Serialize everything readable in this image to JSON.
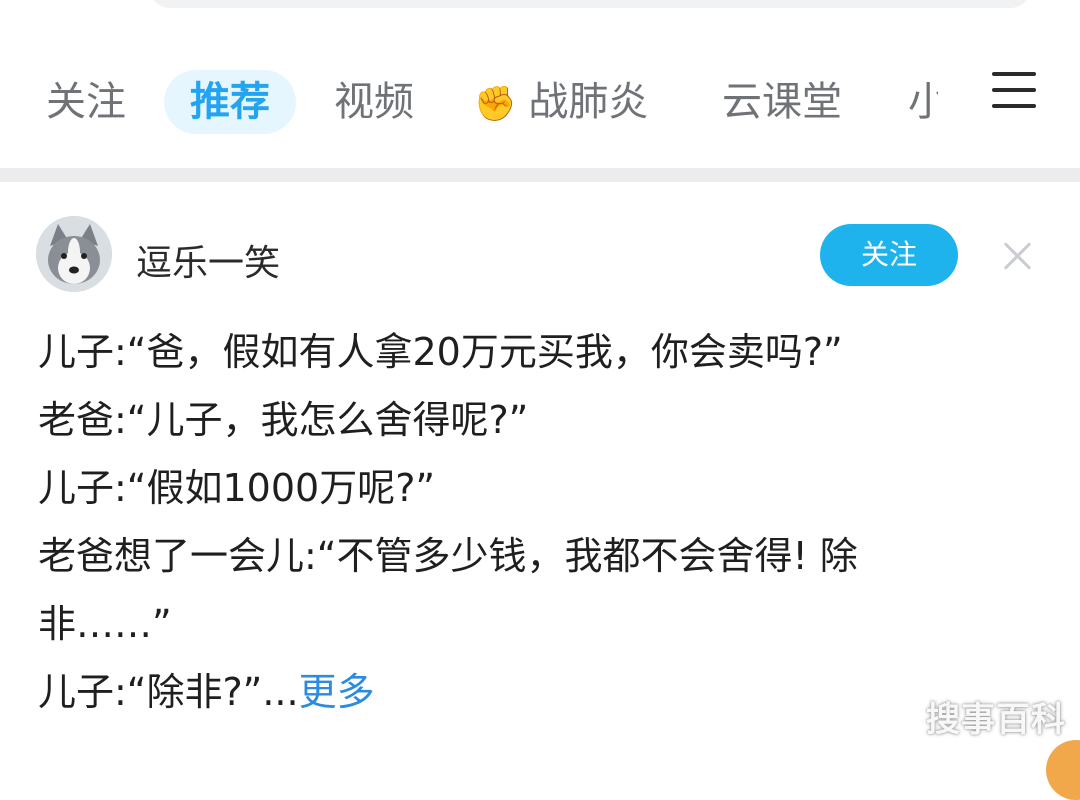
{
  "tabs": [
    {
      "label": "关注",
      "active": false
    },
    {
      "label": "推荐",
      "active": true
    },
    {
      "label": "视频",
      "active": false
    },
    {
      "label": "战肺炎",
      "active": false,
      "icon": "fist-icon"
    },
    {
      "label": "云课堂",
      "active": false
    },
    {
      "label": "小",
      "active": false
    }
  ],
  "post": {
    "author": "逗乐一笑",
    "follow_label": "关注",
    "lines": [
      "儿子:“爸，假如有人拿20万元买我，你会卖吗?”",
      "老爸:“儿子，我怎么舍得呢?”",
      "儿子:“假如1000万呢?”",
      "老爸想了一会儿:“不管多少钱，我都不会舍得! 除",
      "非……”"
    ],
    "last_line": "儿子:“除非?”...",
    "more_label": "更多"
  },
  "watermark": "搜事百科",
  "colors": {
    "accent": "#23a4f0",
    "follow_button": "#1fb3ee",
    "more_link": "#2a8be0"
  }
}
